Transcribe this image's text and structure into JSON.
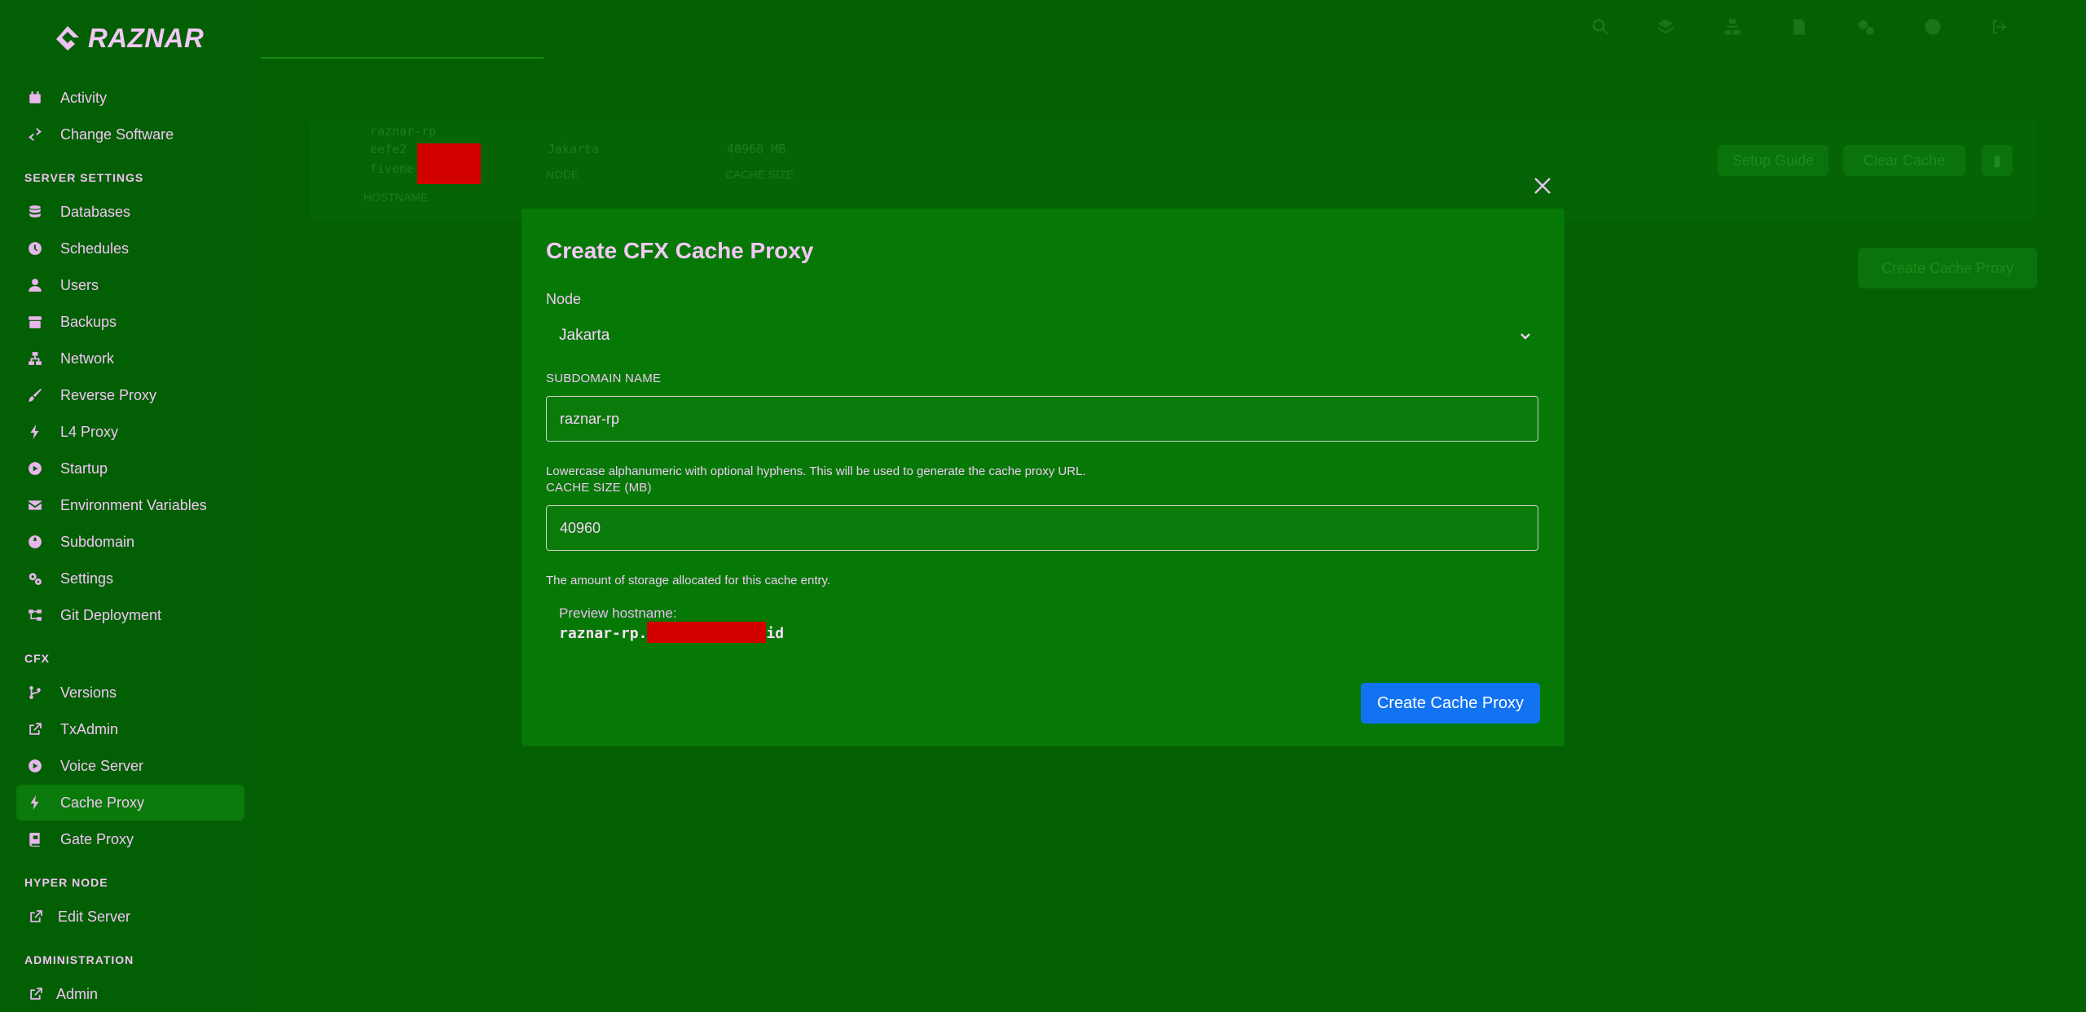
{
  "brand": {
    "name": "RAZNAR"
  },
  "sidebar": {
    "items_top": [
      {
        "label": "Activity",
        "icon": "calendar-icon"
      },
      {
        "label": "Change Software",
        "icon": "swap-icon"
      }
    ],
    "server_settings_title": "SERVER SETTINGS",
    "server_settings": [
      {
        "label": "Databases",
        "icon": "database-icon"
      },
      {
        "label": "Schedules",
        "icon": "clock-icon"
      },
      {
        "label": "Users",
        "icon": "user-icon"
      },
      {
        "label": "Backups",
        "icon": "archive-icon"
      },
      {
        "label": "Network",
        "icon": "network-icon"
      },
      {
        "label": "Reverse Proxy",
        "icon": "brush-icon"
      },
      {
        "label": "L4 Proxy",
        "icon": "bolt-icon"
      },
      {
        "label": "Startup",
        "icon": "play-icon"
      },
      {
        "label": "Environment Variables",
        "icon": "envelope-icon"
      },
      {
        "label": "Subdomain",
        "icon": "globe-icon"
      },
      {
        "label": "Settings",
        "icon": "gears-icon"
      },
      {
        "label": "Git Deployment",
        "icon": "git-icon"
      }
    ],
    "cfx_title": "CFX",
    "cfx": [
      {
        "label": "Versions",
        "icon": "branch-icon"
      },
      {
        "label": "TxAdmin",
        "icon": "external-link-icon"
      },
      {
        "label": "Voice Server",
        "icon": "play-icon"
      },
      {
        "label": "Cache Proxy",
        "icon": "bolt-icon",
        "active": true
      },
      {
        "label": "Gate Proxy",
        "icon": "book-icon"
      }
    ],
    "hyper_node_title": "HYPER NODE",
    "hyper_node": [
      {
        "label": "Edit Server",
        "icon": "external-link-icon"
      }
    ],
    "administration_title": "ADMINISTRATION",
    "administration": [
      {
        "label": "Admin",
        "icon": "external-link-icon"
      }
    ]
  },
  "background": {
    "hostname_line1": "raznar-rp",
    "hostname_line2": "eefe2",
    "hostname_line3": "fiveme",
    "hostname_label": "HOSTNAME",
    "node_value": "Jakarta",
    "node_label": "NODE",
    "cache_value": "40960 MB",
    "cache_label": "CACHE SIZE",
    "setup_guide": "Setup Guide",
    "clear_cache": "Clear Cache",
    "create_cache_proxy": "Create Cache Proxy"
  },
  "modal": {
    "title": "Create CFX Cache Proxy",
    "node_label": "Node",
    "node_value": "Jakarta",
    "subdomain_label": "SUBDOMAIN NAME",
    "subdomain_value": "raznar-rp",
    "subdomain_help": "Lowercase alphanumeric with optional hyphens. This will be used to generate the cache proxy URL.",
    "cache_label": "CACHE SIZE (MB)",
    "cache_value": "40960",
    "cache_help": "The amount of storage allocated for this cache entry.",
    "preview_label": "Preview hostname:",
    "preview_prefix": "raznar-rp.",
    "preview_suffix": "id",
    "submit_label": "Create Cache Proxy"
  }
}
